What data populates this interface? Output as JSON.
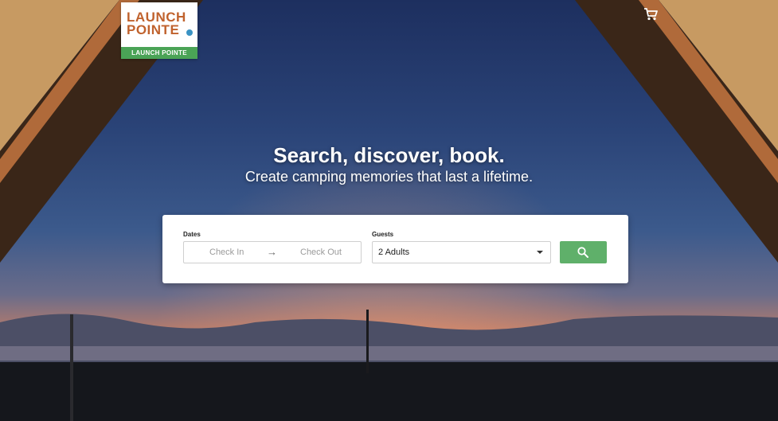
{
  "logo": {
    "line1": "LAUNCH",
    "line2": "POINTE",
    "banner": "LAUNCH POINTE"
  },
  "header": {
    "cart_icon": "cart-icon"
  },
  "hero": {
    "headline": "Search, discover, book.",
    "subheadline": "Create camping memories that last a lifetime."
  },
  "search": {
    "dates_label": "Dates",
    "check_in": "Check In",
    "arrow": "→",
    "check_out": "Check Out",
    "guests_label": "Guests",
    "guests_value": "2 Adults",
    "search_icon": "search-icon"
  },
  "colors": {
    "brand_orange": "#c0622d",
    "brand_green": "#4aa356",
    "button_green": "#5fb06a"
  }
}
